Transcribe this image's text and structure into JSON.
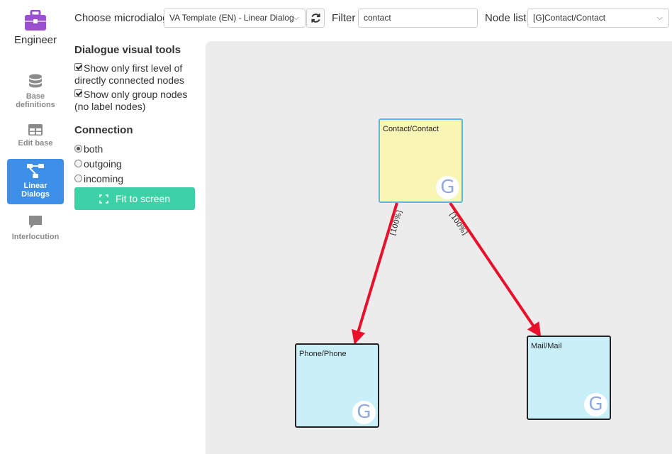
{
  "nav": {
    "brand": "Engineer",
    "items": [
      {
        "label_1": "Base",
        "label_2": "definitions",
        "icon": "database-icon"
      },
      {
        "label_1": "Edit base",
        "icon": "table-icon"
      },
      {
        "label_1": "Linear",
        "label_2": "Dialogs",
        "icon": "hierarchy-icon"
      },
      {
        "label_1": "Interlocution",
        "icon": "chat-icon"
      }
    ]
  },
  "toolbar": {
    "microdialog_label": "Choose microdialog",
    "microdialog_value": "VA Template (EN) - Linear Dialog",
    "filter_label": "Filter",
    "filter_value": "contact",
    "nodelist_label": "Node list",
    "nodelist_value": "[G]Contact/Contact"
  },
  "tools": {
    "title": "Dialogue visual tools",
    "option1_a": "Show only first level of",
    "option1_b": "directly connected nodes",
    "option2_a": "Show only group nodes",
    "option2_b": "(no label nodes)",
    "connection_title": "Connection",
    "radio_both": "both",
    "radio_outgoing": "outgoing",
    "radio_incoming": "incoming",
    "fit_button": "Fit to screen"
  },
  "graph": {
    "nodes": [
      {
        "label": "Contact/Contact",
        "badge": "G",
        "color": "#f9f5b4"
      },
      {
        "label": "Phone/Phone",
        "badge": "G",
        "color": "#c9eff9"
      },
      {
        "label": "Mail/Mail",
        "badge": "G",
        "color": "#c9eff9"
      }
    ],
    "edges": [
      {
        "label": "[100%]"
      },
      {
        "label": "[100%]"
      }
    ],
    "edge_color": "#e8102a"
  }
}
